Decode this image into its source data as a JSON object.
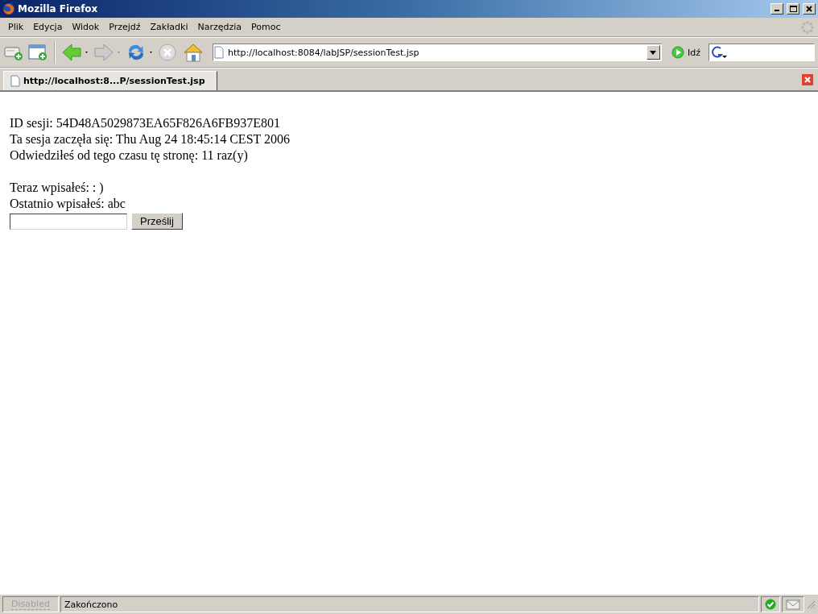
{
  "window": {
    "title": "Mozilla Firefox"
  },
  "menu": [
    "Plik",
    "Edycja",
    "Widok",
    "Przejdź",
    "Zakładki",
    "Narzędzia",
    "Pomoc"
  ],
  "toolbar": {
    "address": "http://localhost:8084/labJSP/sessionTest.jsp",
    "go_label": "Idź"
  },
  "tabs": [
    {
      "label": "http://localhost:8...P/sessionTest.jsp",
      "selected": true
    }
  ],
  "page": {
    "info_lines": [
      "ID sesji: 54D48A5029873EA65F826A6FB937E801",
      "Ta sesja zaczęła się: Thu Aug 24 18:45:14 CEST 2006",
      "Odwiedziłeś od tego czasu tę stronę: 11 raz(y)"
    ],
    "entry_lines": [
      "Teraz wpisałeś: : )",
      "Ostatnio wpisałeś: abc"
    ],
    "submit_button": "Prześlij"
  },
  "status_bar": {
    "disabled_label": "Disabled",
    "status": "Zakończono"
  }
}
